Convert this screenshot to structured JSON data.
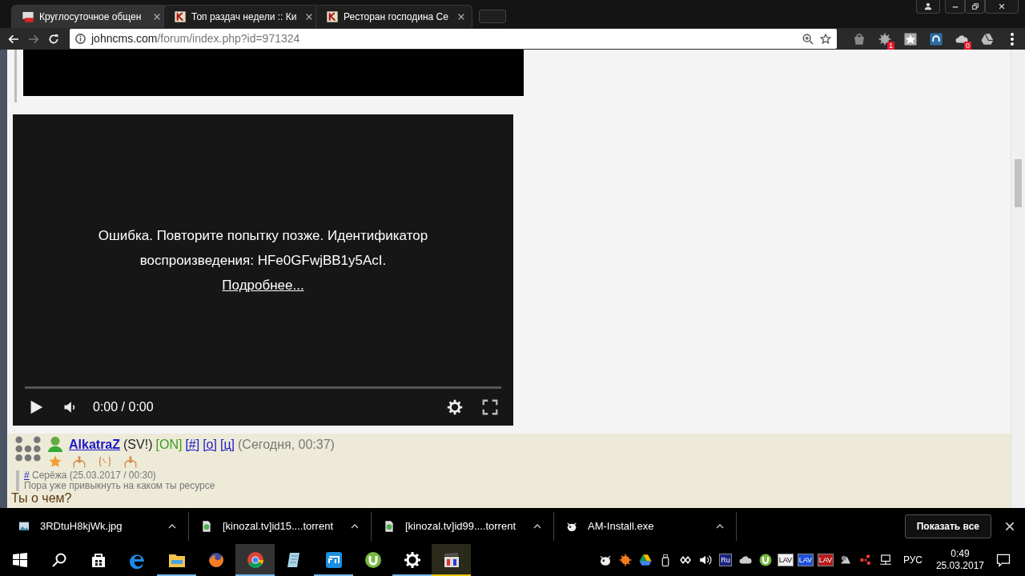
{
  "tabs": [
    {
      "title": "Круглосуточное общен",
      "selected": true
    },
    {
      "title": "Топ раздач недели :: Ки",
      "selected": false
    },
    {
      "title": "Ресторан господина Се",
      "selected": false
    }
  ],
  "address": {
    "host": "johncms.com",
    "path": "/forum/index.php?id=971324"
  },
  "extensions": [
    {
      "kind": "bag"
    },
    {
      "kind": "avast",
      "badge": "1"
    },
    {
      "kind": "star"
    },
    {
      "kind": "headphones"
    },
    {
      "kind": "cloud",
      "badge": "0"
    },
    {
      "kind": "drive"
    }
  ],
  "video": {
    "message": "Ошибка. Повторите попытку позже. Идентификатор воспроизведения: HFe0GFwjBB1y5AcI.",
    "link": "Подробнее...",
    "time": "0:00 / 0:00"
  },
  "post": {
    "author": "AlkatraZ",
    "tag": "(SV!)",
    "status": "[ON]",
    "links": [
      "[#]",
      "[о]",
      "[ц]"
    ],
    "time": "(Сегодня, 00:37)",
    "quote": {
      "link": "#",
      "author": "Серёжа (25.03.2017 / 00:30)",
      "text": "Пора уже привыкнуть на каком ты ресурсе"
    },
    "reply": "Ты о чем?"
  },
  "downloads": [
    {
      "name": "3RDtuH8kjWk.jpg",
      "kind": "image"
    },
    {
      "name": "[kinozal.tv]id15....torrent",
      "kind": "torrent"
    },
    {
      "name": "[kinozal.tv]id99....torrent",
      "kind": "torrent"
    },
    {
      "name": "AM-Install.exe",
      "kind": "cow"
    }
  ],
  "show_all": "Показать все",
  "taskbar": [
    {
      "kind": "start",
      "running": false,
      "selected": false,
      "flashing": false
    },
    {
      "kind": "search",
      "running": false,
      "selected": false,
      "flashing": false
    },
    {
      "kind": "store",
      "running": false,
      "selected": false,
      "flashing": false
    },
    {
      "kind": "edge",
      "running": false,
      "selected": false,
      "flashing": false
    },
    {
      "kind": "explorer",
      "running": true,
      "selected": false,
      "flashing": false
    },
    {
      "kind": "firefox",
      "running": false,
      "selected": false,
      "flashing": false
    },
    {
      "kind": "chrome",
      "running": true,
      "selected": true,
      "flashing": false
    },
    {
      "kind": "notepad",
      "running": false,
      "selected": false,
      "flashing": false
    },
    {
      "kind": "maxthon",
      "running": true,
      "selected": false,
      "flashing": false
    },
    {
      "kind": "utorrent",
      "running": false,
      "selected": false,
      "flashing": false
    },
    {
      "kind": "settings",
      "running": true,
      "selected": false,
      "flashing": false
    },
    {
      "kind": "media",
      "running": true,
      "selected": false,
      "flashing": true
    }
  ],
  "tray": [
    {
      "kind": "cow"
    },
    {
      "kind": "avast"
    },
    {
      "kind": "drive"
    },
    {
      "kind": "usb"
    },
    {
      "kind": "sync"
    },
    {
      "kind": "volume"
    },
    {
      "kind": "badge",
      "label": "Ru",
      "color": "#1a237e"
    },
    {
      "kind": "cloud"
    },
    {
      "kind": "utorrent"
    },
    {
      "kind": "badge",
      "label": "LAV",
      "color": "#f0f0f0"
    },
    {
      "kind": "badge",
      "label": "LAV",
      "color": "#1e4fd8"
    },
    {
      "kind": "badge",
      "label": "LAV",
      "color": "#b71c1c"
    },
    {
      "kind": "speaker"
    },
    {
      "kind": "molecule"
    },
    {
      "kind": "network"
    }
  ],
  "language": "РУС",
  "clock": {
    "time": "0:49",
    "date": "25.03.2017"
  }
}
